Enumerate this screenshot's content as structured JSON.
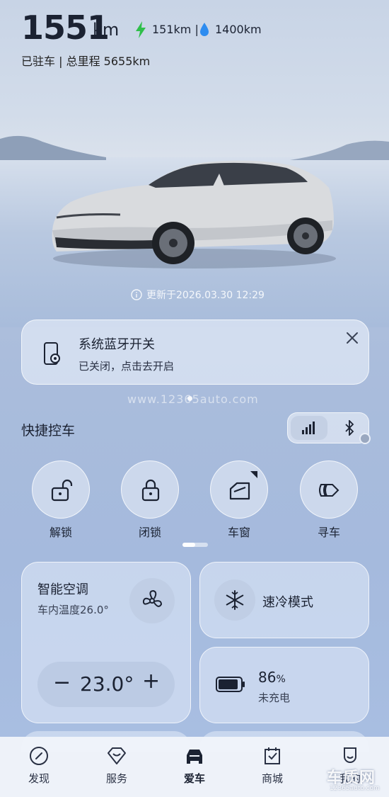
{
  "header": {
    "range_value": "1551",
    "range_unit": "km",
    "electric_range": "151km |",
    "fuel_range": "1400km",
    "status_line": "已驻车 |  总里程 5655km"
  },
  "vehicle": {
    "update_text": "更新于2026.03.30 12:29"
  },
  "bluetooth_card": {
    "title": "系统蓝牙开关",
    "subtitle": "已关闭，点击去开启"
  },
  "watermark_text": "www.12365auto.com",
  "quick_control": {
    "title": "快捷控车",
    "buttons": [
      {
        "label": "解锁",
        "icon": "unlock-icon"
      },
      {
        "label": "闭锁",
        "icon": "lock-icon"
      },
      {
        "label": "车窗",
        "icon": "window-icon"
      },
      {
        "label": "寻车",
        "icon": "horn-icon"
      }
    ]
  },
  "climate": {
    "title": "智能空调",
    "inside_temp": "车内温度26.0°",
    "minus": "−",
    "set_temp": "23.0°",
    "plus": "+"
  },
  "quick_cool": {
    "label": "速冷模式"
  },
  "battery": {
    "percent": "86",
    "percent_unit": "%",
    "status": "未充电"
  },
  "nav": {
    "items": [
      {
        "label": "发现",
        "icon": "discover-icon"
      },
      {
        "label": "服务",
        "icon": "service-icon"
      },
      {
        "label": "爱车",
        "icon": "car-icon"
      },
      {
        "label": "商城",
        "icon": "mall-icon"
      },
      {
        "label": "我的",
        "icon": "profile-icon"
      }
    ],
    "active_index": 2
  },
  "brand_logo": {
    "mark": "车质网",
    "url": "12365auto.com"
  },
  "colors": {
    "electric": "#2fbf4a",
    "fuel": "#2d8cf0",
    "text_dark": "#1b2232"
  }
}
